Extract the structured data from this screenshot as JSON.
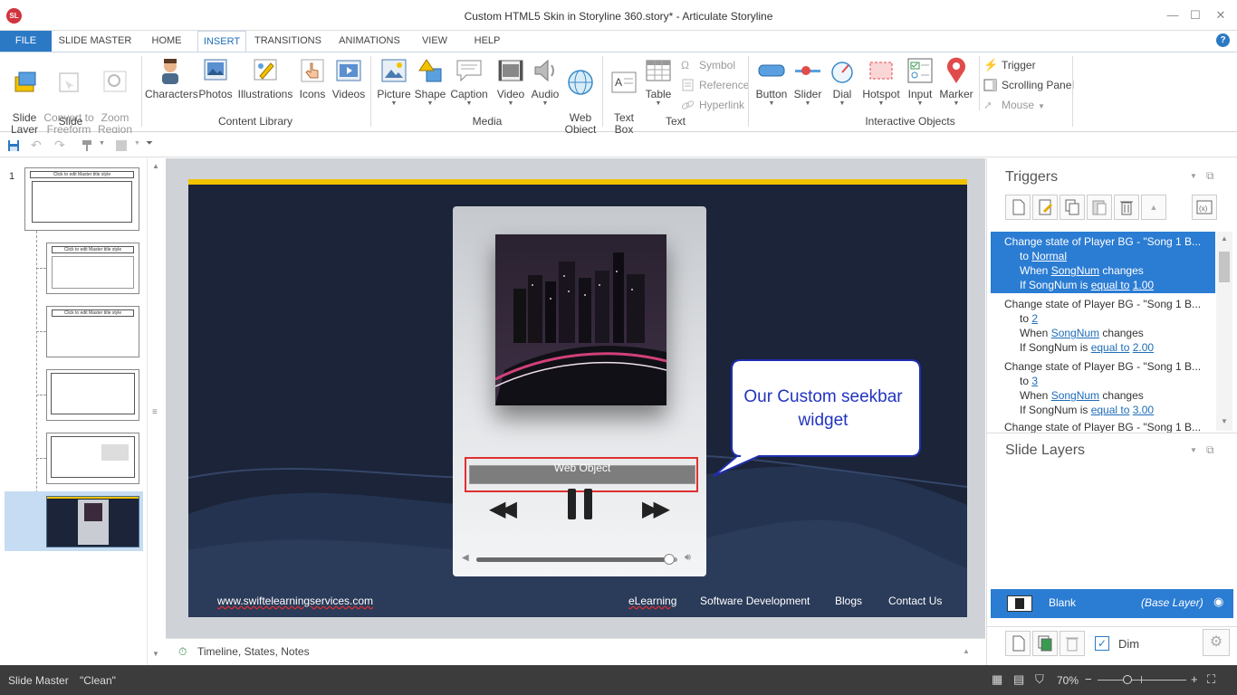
{
  "app": {
    "window_title": "Custom HTML5 Skin in Storyline 360.story* -  Articulate Storyline",
    "icon_text": "SL"
  },
  "tabs": [
    {
      "label": "FILE"
    },
    {
      "label": "SLIDE MASTER"
    },
    {
      "label": "HOME"
    },
    {
      "label": "INSERT"
    },
    {
      "label": "TRANSITIONS"
    },
    {
      "label": "ANIMATIONS"
    },
    {
      "label": "VIEW"
    },
    {
      "label": "HELP"
    }
  ],
  "ribbon": {
    "slide_group": {
      "label": "Slide",
      "slide_layer": "Slide\nLayer",
      "convert": "Convert to\nFreeform",
      "zoom": "Zoom\nRegion"
    },
    "content_group": {
      "label": "Content Library",
      "characters": "Characters",
      "photos": "Photos",
      "illustrations": "Illustrations",
      "icons": "Icons",
      "videos": "Videos"
    },
    "media_group": {
      "label": "Media",
      "picture": "Picture",
      "shape": "Shape",
      "caption": "Caption",
      "video": "Video",
      "audio": "Audio",
      "web_object": "Web\nObject"
    },
    "text_group": {
      "label": "Text",
      "text_box": "Text\nBox",
      "table": "Table",
      "symbol": "Symbol",
      "reference": "Reference",
      "hyperlink": "Hyperlink"
    },
    "interactive_group": {
      "label": "Interactive Objects",
      "button": "Button",
      "slider": "Slider",
      "dial": "Dial",
      "hotspot": "Hotspot",
      "input": "Input",
      "marker": "Marker"
    },
    "trigger_group": {
      "trigger": "Trigger",
      "scrolling_panel": "Scrolling Panel",
      "mouse": "Mouse"
    }
  },
  "slides_panel": {
    "number": "1",
    "master_title": "Click to edit Master title style"
  },
  "slide": {
    "web_object_label": "Web Object",
    "callout": "Our Custom seekbar widget",
    "footer_url": "www.swiftelearningservices.com",
    "footer_links": [
      "eLearning",
      "Software Development",
      "Blogs",
      "Contact Us"
    ],
    "seek_level": 0.96
  },
  "timeline_label": "Timeline, States, Notes",
  "triggers": {
    "title": "Triggers",
    "items": [
      {
        "line1": "Change state of Player BG - \"Song 1 B...",
        "to_prefix": "to ",
        "to_value": "Normal",
        "when_prefix": "When ",
        "var": "SongNum",
        "when_suffix": " changes",
        "if_prefix": "If SongNum is ",
        "cond": "equal to",
        "value": "1.00",
        "selected": true
      },
      {
        "line1": "Change state of Player BG - \"Song 1 B...",
        "to_prefix": "to ",
        "to_value": "2",
        "when_prefix": "When ",
        "var": "SongNum",
        "when_suffix": " changes",
        "if_prefix": "If SongNum is ",
        "cond": "equal to",
        "value": "2.00",
        "selected": false
      },
      {
        "line1": "Change state of Player BG - \"Song 1 B...",
        "to_prefix": "to ",
        "to_value": "3",
        "when_prefix": "When ",
        "var": "SongNum",
        "when_suffix": " changes",
        "if_prefix": "If SongNum is ",
        "cond": "equal to",
        "value": "3.00",
        "selected": false
      }
    ],
    "partial_line": "Change state of Player BG - \"Song 1 B..."
  },
  "slide_layers": {
    "title": "Slide Layers",
    "base_name": "Blank",
    "base_tag": "(Base Layer)",
    "dim_label": "Dim",
    "dim_checked": true
  },
  "status": {
    "view": "Slide Master",
    "theme": "\"Clean\"",
    "zoom": "70%"
  },
  "colors": {
    "accent": "#2b79c5",
    "slide_bg": "#1b2438",
    "gold_bar": "#f2c200",
    "selection": "#2b7cd3"
  }
}
